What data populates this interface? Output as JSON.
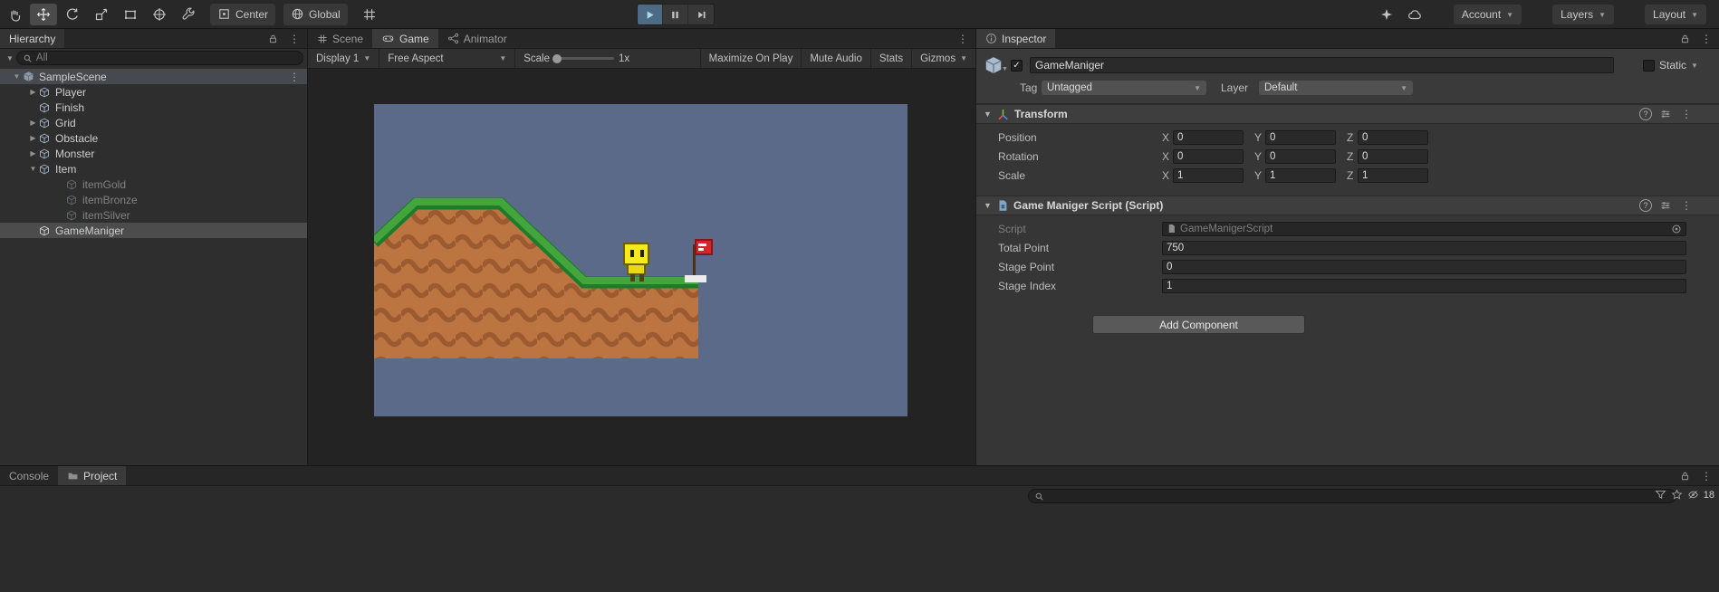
{
  "toolbar": {
    "tools": [
      "hand-tool",
      "move-tool",
      "rotate-tool",
      "scale-tool",
      "rect-tool",
      "transform-tool",
      "custom-tool"
    ],
    "selected_tool": "move-tool",
    "pivot_label": "Center",
    "space_label": "Global",
    "play_state": "playing",
    "account_label": "Account",
    "layers_label": "Layers",
    "layout_label": "Layout"
  },
  "hierarchy": {
    "title": "Hierarchy",
    "search_placeholder": "All",
    "items": [
      {
        "label": "SampleScene",
        "type": "scene",
        "selected": true,
        "expanded": true
      },
      {
        "label": "Player"
      },
      {
        "label": "Finish"
      },
      {
        "label": "Grid"
      },
      {
        "label": "Obstacle"
      },
      {
        "label": "Monster"
      },
      {
        "label": "Item",
        "expanded": true
      },
      {
        "label": "itemGold",
        "inactive": true
      },
      {
        "label": "itemBronze",
        "inactive": true
      },
      {
        "label": "itemSilver",
        "inactive": true
      },
      {
        "label": "GameManiger",
        "selected": true
      }
    ]
  },
  "game_view": {
    "tabs": [
      {
        "label": "Scene"
      },
      {
        "label": "Game",
        "active": true
      },
      {
        "label": "Animator"
      }
    ],
    "toolbar": {
      "display": "Display 1",
      "aspect": "Free Aspect",
      "scale_label": "Scale",
      "scale_value": "1x",
      "maximize_label": "Maximize On Play",
      "mute_label": "Mute Audio",
      "stats_label": "Stats",
      "gizmos_label": "Gizmos"
    },
    "scene_colors": {
      "background": "#5a6a88",
      "terrain": "#bc7440",
      "terrain_wave": "#9c5a30",
      "grass": "#43a53c",
      "grass_shadow": "#1d7c2a",
      "player": "#f6ea1c",
      "flag": "#d5262b"
    }
  },
  "inspector": {
    "title": "Inspector",
    "axes": [
      "X",
      "Y",
      "Z"
    ],
    "object": {
      "name": "GameManiger",
      "active": true,
      "static_label": "Static",
      "tag_label": "Tag",
      "tag": "Untagged",
      "layer_label": "Layer",
      "layer": "Default"
    },
    "transform": {
      "title": "Transform",
      "rows": [
        {
          "label": "Position",
          "x": "0",
          "y": "0",
          "z": "0"
        },
        {
          "label": "Rotation",
          "x": "0",
          "y": "0",
          "z": "0"
        },
        {
          "label": "Scale",
          "x": "1",
          "y": "1",
          "z": "1"
        }
      ]
    },
    "script": {
      "title": "Game Maniger Script (Script)",
      "fields": [
        {
          "label": "Script",
          "value": "GameManigerScript",
          "disabled": true
        },
        {
          "label": "Total Point",
          "value": "750"
        },
        {
          "label": "Stage Point",
          "value": "0"
        },
        {
          "label": "Stage Index",
          "value": "1"
        }
      ]
    },
    "add_component_label": "Add Component"
  },
  "bottom_panel": {
    "tabs": [
      {
        "label": "Console"
      },
      {
        "label": "Project",
        "active": true
      }
    ],
    "search_placeholder": "",
    "hidden_count": "18"
  }
}
